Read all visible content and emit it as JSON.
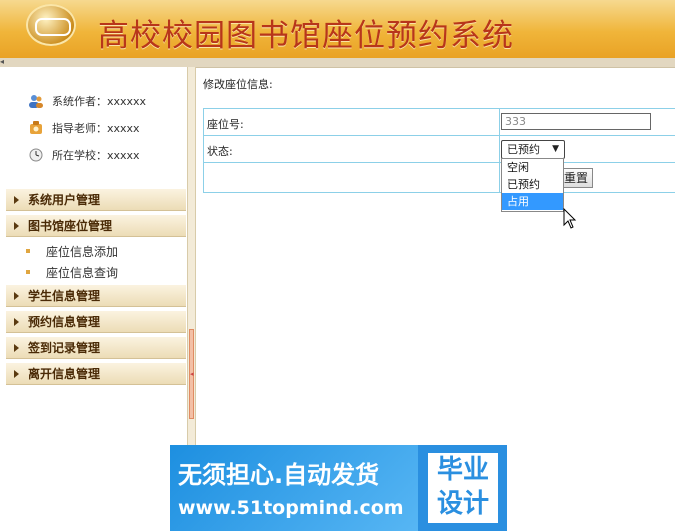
{
  "header": {
    "title": "高校校园图书馆座位预约系统"
  },
  "sidebar": {
    "info": [
      {
        "label": "系统作者：xxxxxx",
        "icon": "users-icon"
      },
      {
        "label": "指导老师：xxxxx",
        "icon": "teacher-icon"
      },
      {
        "label": "所在学校：xxxxx",
        "icon": "clock-icon"
      }
    ],
    "menus": [
      {
        "label": "系统用户管理"
      },
      {
        "label": "图书馆座位管理"
      },
      {
        "label": "学生信息管理"
      },
      {
        "label": "预约信息管理"
      },
      {
        "label": "签到记录管理"
      },
      {
        "label": "离开信息管理"
      }
    ],
    "submenus": [
      {
        "label": "座位信息添加"
      },
      {
        "label": "座位信息查询"
      }
    ]
  },
  "main": {
    "title": "修改座位信息:",
    "form": {
      "seat_label": "座位号:",
      "seat_value": "333",
      "status_label": "状态:",
      "status_selected": "已预约",
      "status_options": [
        "空闲",
        "已预约",
        "占用"
      ],
      "highlighted_option": "占用",
      "reset_label": "重置"
    }
  },
  "watermark": {
    "line1": "无须担心.自动发货",
    "line2": "www.51topmind.com",
    "badge": "毕业设计"
  },
  "colors": {
    "accent": "#e9a225",
    "title": "#b8361a",
    "table_border": "#8cd0e8",
    "selection": "#3399ff"
  }
}
